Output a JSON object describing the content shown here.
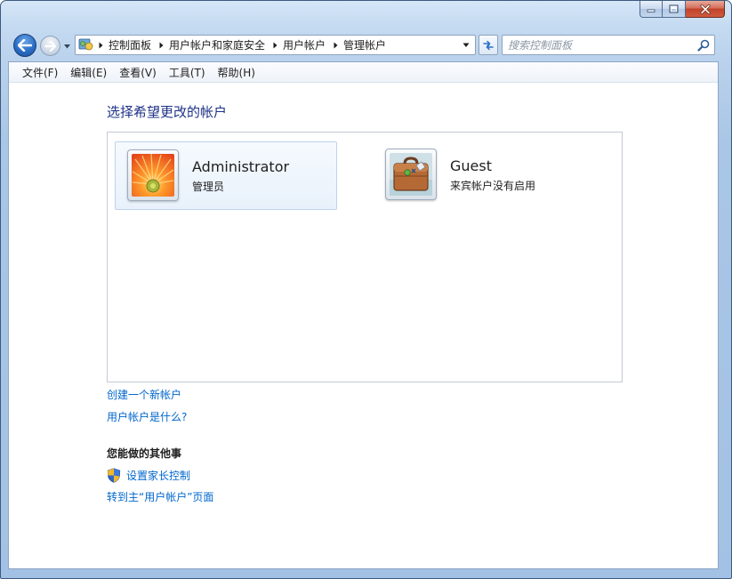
{
  "window": {
    "caption_buttons": [
      "minimize-icon",
      "maximize-icon",
      "close-icon"
    ]
  },
  "address": {
    "icon": "control-panel-icon",
    "crumbs": [
      "控制面板",
      "用户帐户和家庭安全",
      "用户帐户",
      "管理帐户"
    ]
  },
  "search": {
    "placeholder": "搜索控制面板"
  },
  "menu": {
    "file": "文件(F)",
    "edit": "编辑(E)",
    "view": "查看(V)",
    "tools": "工具(T)",
    "help": "帮助(H)"
  },
  "main": {
    "title": "选择希望更改的帐户",
    "accounts": [
      {
        "name": "Administrator",
        "status": "管理员",
        "picture": "orange-flower-picture"
      },
      {
        "name": "Guest",
        "status": "来宾帐户没有启用",
        "picture": "briefcase-picture"
      }
    ],
    "links": {
      "create": "创建一个新帐户",
      "what_is": "用户帐户是什么?"
    },
    "other_heading": "您能做的其他事",
    "other_links": {
      "parental": "设置家长控制",
      "main_page": "转到主“用户帐户”页面"
    }
  },
  "colors": {
    "title_text": "#1e3287",
    "link": "#0066cc",
    "frame": "#a3c1e4",
    "close_button": "#c0422a"
  }
}
